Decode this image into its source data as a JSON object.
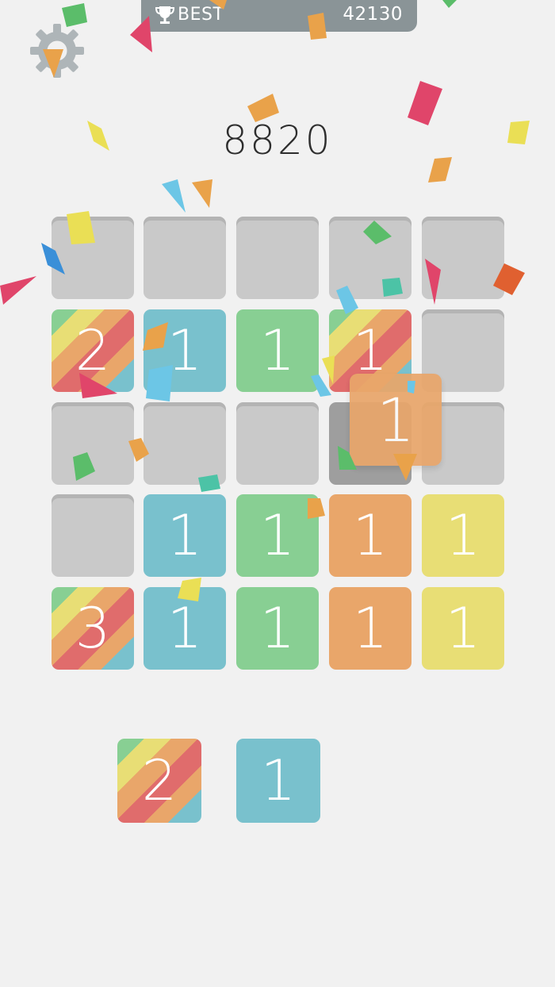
{
  "header": {
    "best_label": "BEST",
    "best_value": "42130"
  },
  "score": "8820",
  "icons": {
    "trophy": "trophy-icon",
    "settings": "gear-icon"
  },
  "colors": {
    "empty": "#c9c9c9",
    "blue": "#79c1cd",
    "green": "#88cf93",
    "orange": "#e9a66a",
    "yellow": "#e8de75",
    "red": "#e06c6c",
    "best_bar": "#8a9497"
  },
  "board": {
    "rows": [
      [
        {
          "type": "empty",
          "value": ""
        },
        {
          "type": "empty",
          "value": ""
        },
        {
          "type": "empty",
          "value": ""
        },
        {
          "type": "empty",
          "value": ""
        },
        {
          "type": "empty",
          "value": ""
        }
      ],
      [
        {
          "type": "rainbow",
          "value": "2"
        },
        {
          "type": "blue",
          "value": "1"
        },
        {
          "type": "green",
          "value": "1"
        },
        {
          "type": "rainbow",
          "value": "1"
        },
        {
          "type": "empty",
          "value": ""
        }
      ],
      [
        {
          "type": "empty",
          "value": ""
        },
        {
          "type": "empty",
          "value": ""
        },
        {
          "type": "empty",
          "value": ""
        },
        {
          "type": "dark",
          "value": ""
        },
        {
          "type": "empty",
          "value": ""
        }
      ],
      [
        {
          "type": "empty",
          "value": ""
        },
        {
          "type": "blue",
          "value": "1"
        },
        {
          "type": "green",
          "value": "1"
        },
        {
          "type": "orange",
          "value": "1"
        },
        {
          "type": "yellow",
          "value": "1"
        }
      ],
      [
        {
          "type": "rainbow",
          "value": "3"
        },
        {
          "type": "blue",
          "value": "1"
        },
        {
          "type": "green",
          "value": "1"
        },
        {
          "type": "orange",
          "value": "1"
        },
        {
          "type": "yellow",
          "value": "1"
        }
      ]
    ]
  },
  "floating_tile": {
    "type": "orange",
    "value": "1"
  },
  "next_tiles": [
    {
      "type": "rainbow",
      "value": "2"
    },
    {
      "type": "blue",
      "value": "1"
    }
  ]
}
